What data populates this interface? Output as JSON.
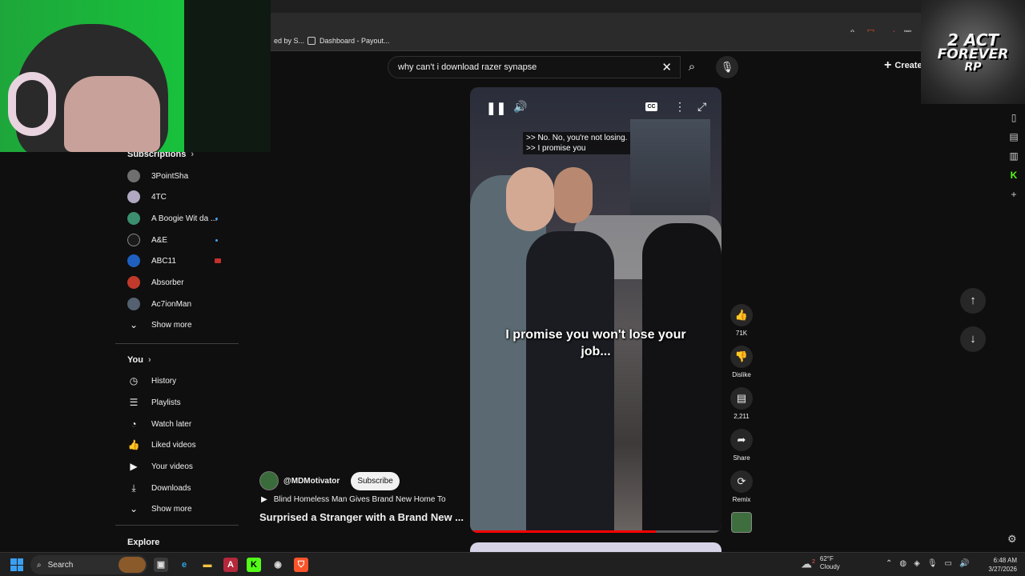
{
  "browser": {
    "bookmarks": [
      {
        "label": "ed by S..."
      },
      {
        "label": "Dashboard - Payout..."
      }
    ],
    "extension_icons": [
      "panel-icon",
      "share-icon",
      "brave-shield-icon",
      "brave-rewards-icon",
      "wallet-icon"
    ],
    "extension_badge": "1"
  },
  "overlay_logo": {
    "line1": "2 ACT",
    "line2": "FOREVER",
    "line3": "RP"
  },
  "search": {
    "value": "why can't i download razer synapse",
    "placeholder": "Search"
  },
  "header": {
    "create_label": "Create"
  },
  "sidebar": {
    "subscriptions_title": "Subscriptions",
    "subscriptions": [
      {
        "label": "3PointSha",
        "color": "#6f6f6f",
        "indicator": "none"
      },
      {
        "label": "4TC",
        "color": "#b0a7c0",
        "indicator": "none"
      },
      {
        "label": "A Boogie Wit da ...",
        "color": "#3c8f6e",
        "indicator": "dot"
      },
      {
        "label": "A&E",
        "color": "#1a1a1a",
        "indicator": "dot"
      },
      {
        "label": "ABC11",
        "color": "#1f5fbf",
        "indicator": "live"
      },
      {
        "label": "Absorber",
        "color": "#c0392b",
        "indicator": "none"
      },
      {
        "label": "Ac7ionMan",
        "color": "#556070",
        "indicator": "none"
      }
    ],
    "subs_show_more": "Show more",
    "you_title": "You",
    "you_items": [
      {
        "label": "History",
        "icon": "history-icon"
      },
      {
        "label": "Playlists",
        "icon": "playlists-icon"
      },
      {
        "label": "Watch later",
        "icon": "watch-later-icon"
      },
      {
        "label": "Liked videos",
        "icon": "like-icon"
      },
      {
        "label": "Your videos",
        "icon": "your-videos-icon"
      },
      {
        "label": "Downloads",
        "icon": "download-icon"
      }
    ],
    "you_show_more": "Show more",
    "explore_title": "Explore"
  },
  "short": {
    "caption_line1": ">> No. No, you're not losing.",
    "caption_line2": ">> I promise you",
    "burned_subtitle": "I promise you won't lose your job...",
    "progress": 0.74
  },
  "channel": {
    "handle": "@MDMotivator",
    "subscribe_label": "Subscribe",
    "playlist_label": "Blind Homeless Man Gives Brand New Home To",
    "video_title": "Surprised a Stranger with a Brand New ..."
  },
  "actions": {
    "like_count": "71K",
    "dislike_label": "Dislike",
    "comment_count": "2,211",
    "share_label": "Share",
    "remix_label": "Remix"
  },
  "taskbar": {
    "search_label": "Search",
    "weather_temp": "62°F",
    "weather_desc": "Cloudy",
    "weather_badge": "2",
    "time": "6:48 AM",
    "date": "3/27/2026"
  }
}
